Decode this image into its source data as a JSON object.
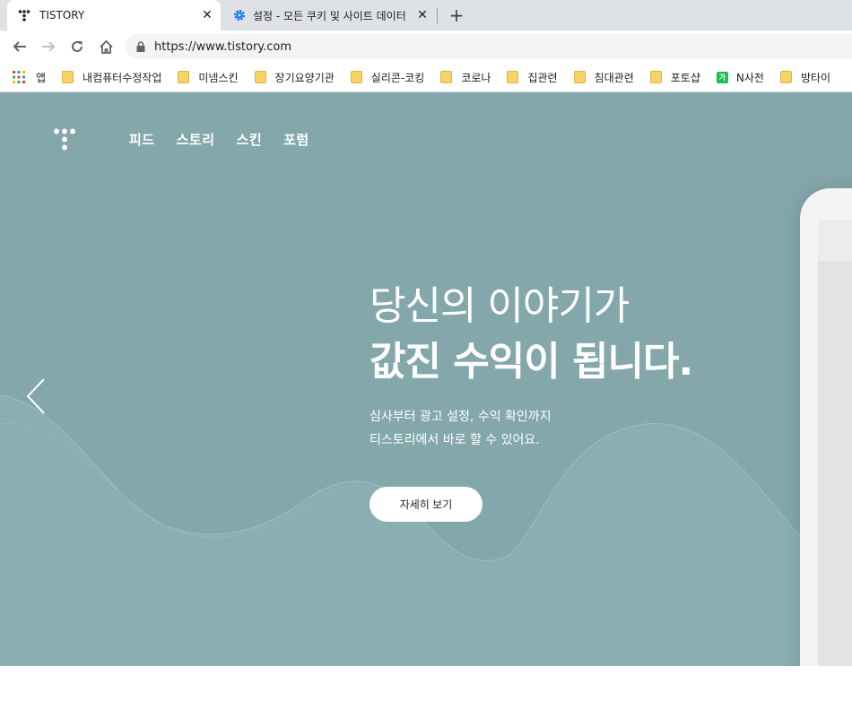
{
  "browser": {
    "tabs": [
      {
        "title": "TISTORY",
        "active": true
      },
      {
        "title": "설정 - 모든 쿠키 및 사이트 데이터",
        "active": false
      }
    ],
    "url": "https://www.tistory.com",
    "bookmarks": [
      {
        "label": "앱",
        "icon": "apps-grid-icon"
      },
      {
        "label": "내컴퓨터수정작업",
        "icon": "folder-icon"
      },
      {
        "label": "미넴스킨",
        "icon": "folder-icon"
      },
      {
        "label": "장기요양기관",
        "icon": "folder-icon"
      },
      {
        "label": "실리콘-코킹",
        "icon": "folder-icon"
      },
      {
        "label": "코로나",
        "icon": "folder-icon"
      },
      {
        "label": "집관련",
        "icon": "folder-icon"
      },
      {
        "label": "침대관련",
        "icon": "folder-icon"
      },
      {
        "label": "포토샵",
        "icon": "folder-icon"
      },
      {
        "label": "N사전",
        "icon": "naver-dictionary-icon"
      },
      {
        "label": "방타이",
        "icon": "folder-icon"
      }
    ]
  },
  "page": {
    "nav": [
      "피드",
      "스토리",
      "스킨",
      "포럼"
    ],
    "hero": {
      "line1": "당신의 이야기가",
      "line2": "값진 수익이 됩니다.",
      "desc1": "심사부터 광고 설정, 수익 확인까지",
      "desc2": "티스토리에서 바로 할 수 있어요.",
      "cta": "자세히 보기"
    }
  },
  "colors": {
    "hero_bg": "#84a7ab",
    "tab_bar": "#dee1e6",
    "text_white": "#ffffff"
  }
}
